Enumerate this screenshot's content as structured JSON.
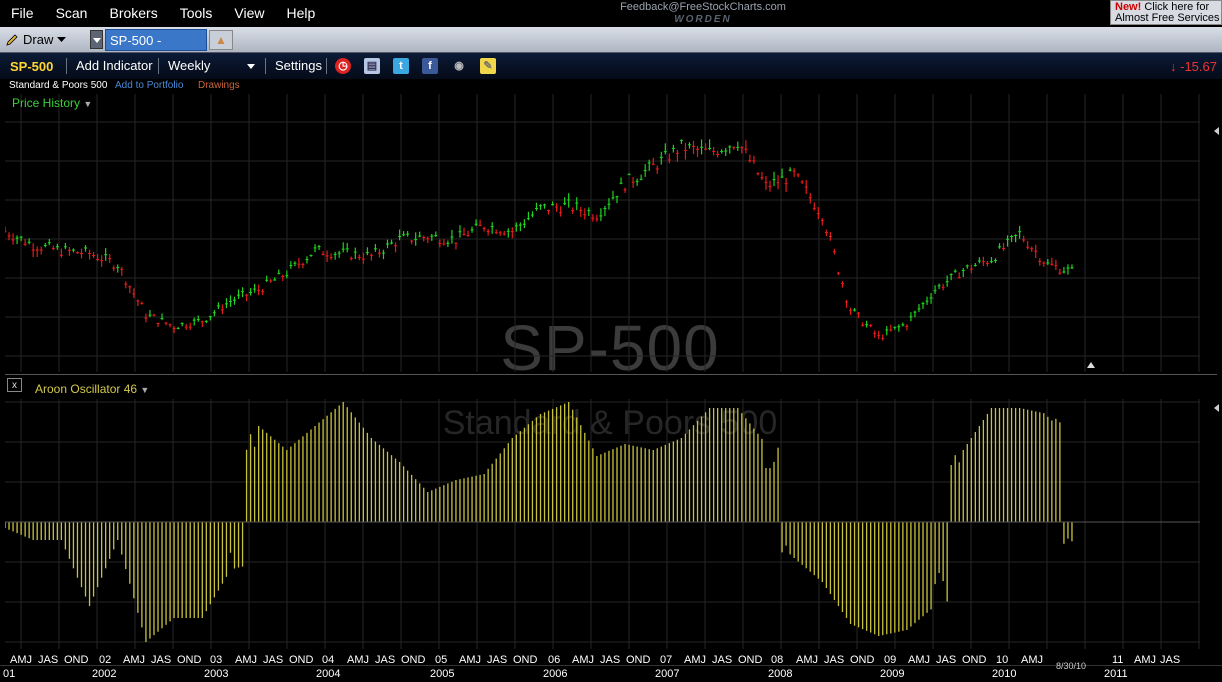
{
  "menu": {
    "items": [
      "File",
      "Scan",
      "Brokers",
      "Tools",
      "View",
      "Help"
    ]
  },
  "feedback": {
    "email": "Feedback@FreeStockCharts.com",
    "brand": "WORDEN"
  },
  "promo": {
    "new_label": "New!",
    "text": "Click here for",
    "line2": "Almost Free Services"
  },
  "tabbar": {
    "draw_label": "Draw",
    "active_tab": "SP-500 - Weekly"
  },
  "toolbar": {
    "symbol": "SP-500",
    "add_indicator": "Add Indicator",
    "period": "Weekly",
    "settings": "Settings",
    "change": "-15.67"
  },
  "subinfo": {
    "name": "Standard & Poors 500",
    "add_portfolio": "Add to Portfolio",
    "drawings": "Drawings"
  },
  "price_pane": {
    "label": "Price History",
    "watermark_symbol": "SP-500",
    "watermark_name": "Standard & Poors 500"
  },
  "indicator_pane": {
    "close": "x",
    "label": "Aroon Oscillator 46"
  },
  "time_axis": {
    "labels": [
      "AMJ",
      "JAS",
      "OND",
      "02",
      "AMJ",
      "JAS",
      "OND",
      "03",
      "AMJ",
      "JAS",
      "OND",
      "04",
      "AMJ",
      "JAS",
      "OND",
      "05",
      "AMJ",
      "JAS",
      "OND",
      "06",
      "AMJ",
      "JAS",
      "OND",
      "07",
      "AMJ",
      "JAS",
      "OND",
      "08",
      "AMJ",
      "JAS",
      "OND",
      "09",
      "AMJ",
      "JAS",
      "OND",
      "10",
      "AMJ",
      "11",
      "AMJ",
      "JAS"
    ],
    "years": [
      "01",
      "2002",
      "2003",
      "2004",
      "2005",
      "2006",
      "2007",
      "2008",
      "2009",
      "2010",
      "2011"
    ],
    "last_date": "8/30/10"
  },
  "colors": {
    "up": "#1fd21f",
    "down": "#e21b1b",
    "aroon": "#c8c23a",
    "grid": "#262626",
    "accent": "#3a77c8"
  },
  "chart_data": [
    {
      "type": "bar",
      "title": "SP-500",
      "series_name": "Price History (weekly OHLC)",
      "x": [
        "2001-04",
        "2001-07",
        "2001-10",
        "2002-01",
        "2002-04",
        "2002-07",
        "2002-10",
        "2003-01",
        "2003-04",
        "2003-07",
        "2003-10",
        "2004-01",
        "2004-04",
        "2004-07",
        "2004-10",
        "2005-01",
        "2005-04",
        "2005-07",
        "2005-10",
        "2006-01",
        "2006-04",
        "2006-07",
        "2006-10",
        "2007-01",
        "2007-04",
        "2007-07",
        "2007-10",
        "2008-01",
        "2008-04",
        "2008-07",
        "2008-10",
        "2009-01",
        "2009-04",
        "2009-07",
        "2009-10",
        "2010-01",
        "2010-04",
        "2010-07",
        "2010-08"
      ],
      "values": [
        1200,
        1150,
        1130,
        1120,
        1080,
        900,
        860,
        880,
        950,
        990,
        1050,
        1130,
        1120,
        1110,
        1170,
        1180,
        1170,
        1220,
        1200,
        1280,
        1290,
        1260,
        1370,
        1430,
        1500,
        1480,
        1520,
        1360,
        1400,
        1260,
        920,
        820,
        870,
        990,
        1060,
        1100,
        1190,
        1080,
        1050
      ]
    },
    {
      "type": "bar",
      "title": "Aroon Oscillator 46",
      "x": [
        "2001-04",
        "2001-07",
        "2001-10",
        "2002-01",
        "2002-04",
        "2002-07",
        "2002-10",
        "2003-01",
        "2003-04",
        "2003-07",
        "2003-10",
        "2004-01",
        "2004-04",
        "2004-07",
        "2004-10",
        "2005-01",
        "2005-04",
        "2005-07",
        "2005-10",
        "2006-01",
        "2006-04",
        "2006-07",
        "2006-10",
        "2007-01",
        "2007-04",
        "2007-07",
        "2007-10",
        "2008-01",
        "2008-04",
        "2008-07",
        "2008-10",
        "2009-01",
        "2009-04",
        "2009-07",
        "2009-10",
        "2010-01",
        "2010-04",
        "2010-07",
        "2010-08"
      ],
      "values": [
        -5,
        -15,
        -15,
        -70,
        -15,
        -100,
        -80,
        -80,
        -40,
        80,
        60,
        80,
        100,
        70,
        50,
        25,
        35,
        40,
        70,
        90,
        100,
        55,
        65,
        60,
        70,
        95,
        95,
        65,
        -30,
        -50,
        -85,
        -95,
        -90,
        -70,
        60,
        95,
        95,
        90,
        -20
      ],
      "ylim": [
        -100,
        100
      ]
    }
  ]
}
